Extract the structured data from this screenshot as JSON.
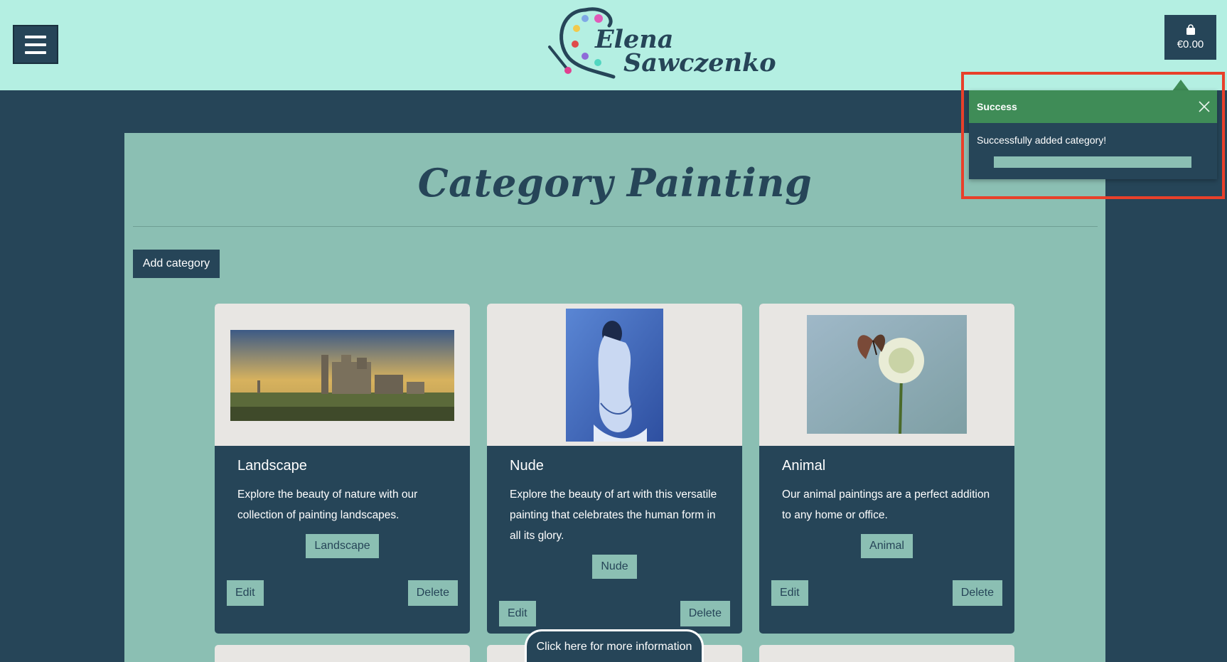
{
  "header": {
    "logo_line1": "Elena",
    "logo_line2": "Sawczenko",
    "cart_total": "€0.00"
  },
  "main": {
    "title": "Category Painting",
    "add_button": "Add category"
  },
  "cards": [
    {
      "title": "Landscape",
      "description": "Explore the beauty of nature with our collection of painting landscapes.",
      "badge": "Landscape",
      "edit": "Edit",
      "delete": "Delete"
    },
    {
      "title": "Nude",
      "description": "Explore the beauty of art with this versatile painting that celebrates the human form in all its glory.",
      "badge": "Nude",
      "edit": "Edit",
      "delete": "Delete"
    },
    {
      "title": "Animal",
      "description": "Our animal paintings are a perfect addition to any home or office.",
      "badge": "Animal",
      "edit": "Edit",
      "delete": "Delete"
    }
  ],
  "info_button": "Click here for more information",
  "toast": {
    "title": "Success",
    "message": "Successfully added category!"
  },
  "colors": {
    "header_bg": "#b4efe2",
    "dark": "#264558",
    "panel": "#8bbfb3",
    "success": "#3f8c57",
    "highlight": "#e8402a"
  },
  "icons": {
    "menu": "hamburger-icon",
    "cart": "shopping-bag-icon",
    "close": "close-icon"
  }
}
